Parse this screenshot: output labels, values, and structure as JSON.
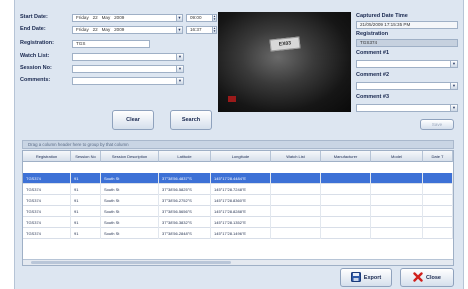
{
  "form": {
    "start_date_label": "Start Date:",
    "end_date_label": "End Date:",
    "registration_label": "Registration:",
    "watch_list_label": "Watch List:",
    "session_no_label": "Session No:",
    "comments_label": "Comments:",
    "start_day": "Friday",
    "start_dd": "22",
    "start_month": "May",
    "start_year": "2009",
    "start_time": "09:00",
    "end_day": "Friday",
    "end_dd": "22",
    "end_month": "May",
    "end_year": "2009",
    "end_time": "16:37",
    "registration_value": "TGS"
  },
  "buttons": {
    "clear": "Clear",
    "search": "Search",
    "save": "Save",
    "export": "Export",
    "close": "Close"
  },
  "photo": {
    "plate_text": "EX03"
  },
  "details": {
    "captured_label": "Captured Date Time",
    "captured_value": "21/05/2009 17:15:35 PM",
    "registration_label": "Registration",
    "registration_value": "TGS374",
    "comment1_label": "Comment #1",
    "comment2_label": "Comment #2",
    "comment3_label": "Comment #3"
  },
  "grid": {
    "group_hint": "Drag a column header here to group by that column",
    "columns": [
      "Registration",
      "Session No",
      "Session Description",
      "Latitude",
      "Longitude",
      "Watch List",
      "Manufacturer",
      "Model",
      "Date T"
    ],
    "rows": [
      [
        "TGS374",
        "91",
        "South St",
        "37°38'56.4837\"S",
        "145°17'28.4484\"E",
        "",
        "",
        "",
        ""
      ],
      [
        "TGS374",
        "91",
        "South St",
        "37°38'56.5825\"S",
        "145°17'28.7248\"E",
        "",
        "",
        "",
        ""
      ],
      [
        "TGS374",
        "91",
        "South St",
        "37°38'56.2752\"S",
        "145°17'28.8360\"E",
        "",
        "",
        "",
        ""
      ],
      [
        "TGS374",
        "91",
        "South St",
        "37°38'56.5656\"S",
        "145°17'28.8288\"E",
        "",
        "",
        "",
        ""
      ],
      [
        "TGS374",
        "91",
        "South St",
        "37°38'56.3832\"S",
        "145°17'28.1352\"E",
        "",
        "",
        "",
        ""
      ],
      [
        "TGS374",
        "91",
        "South St",
        "37°38'56.2848\"S",
        "145°17'28.1496\"E",
        "",
        "",
        "",
        ""
      ]
    ]
  }
}
